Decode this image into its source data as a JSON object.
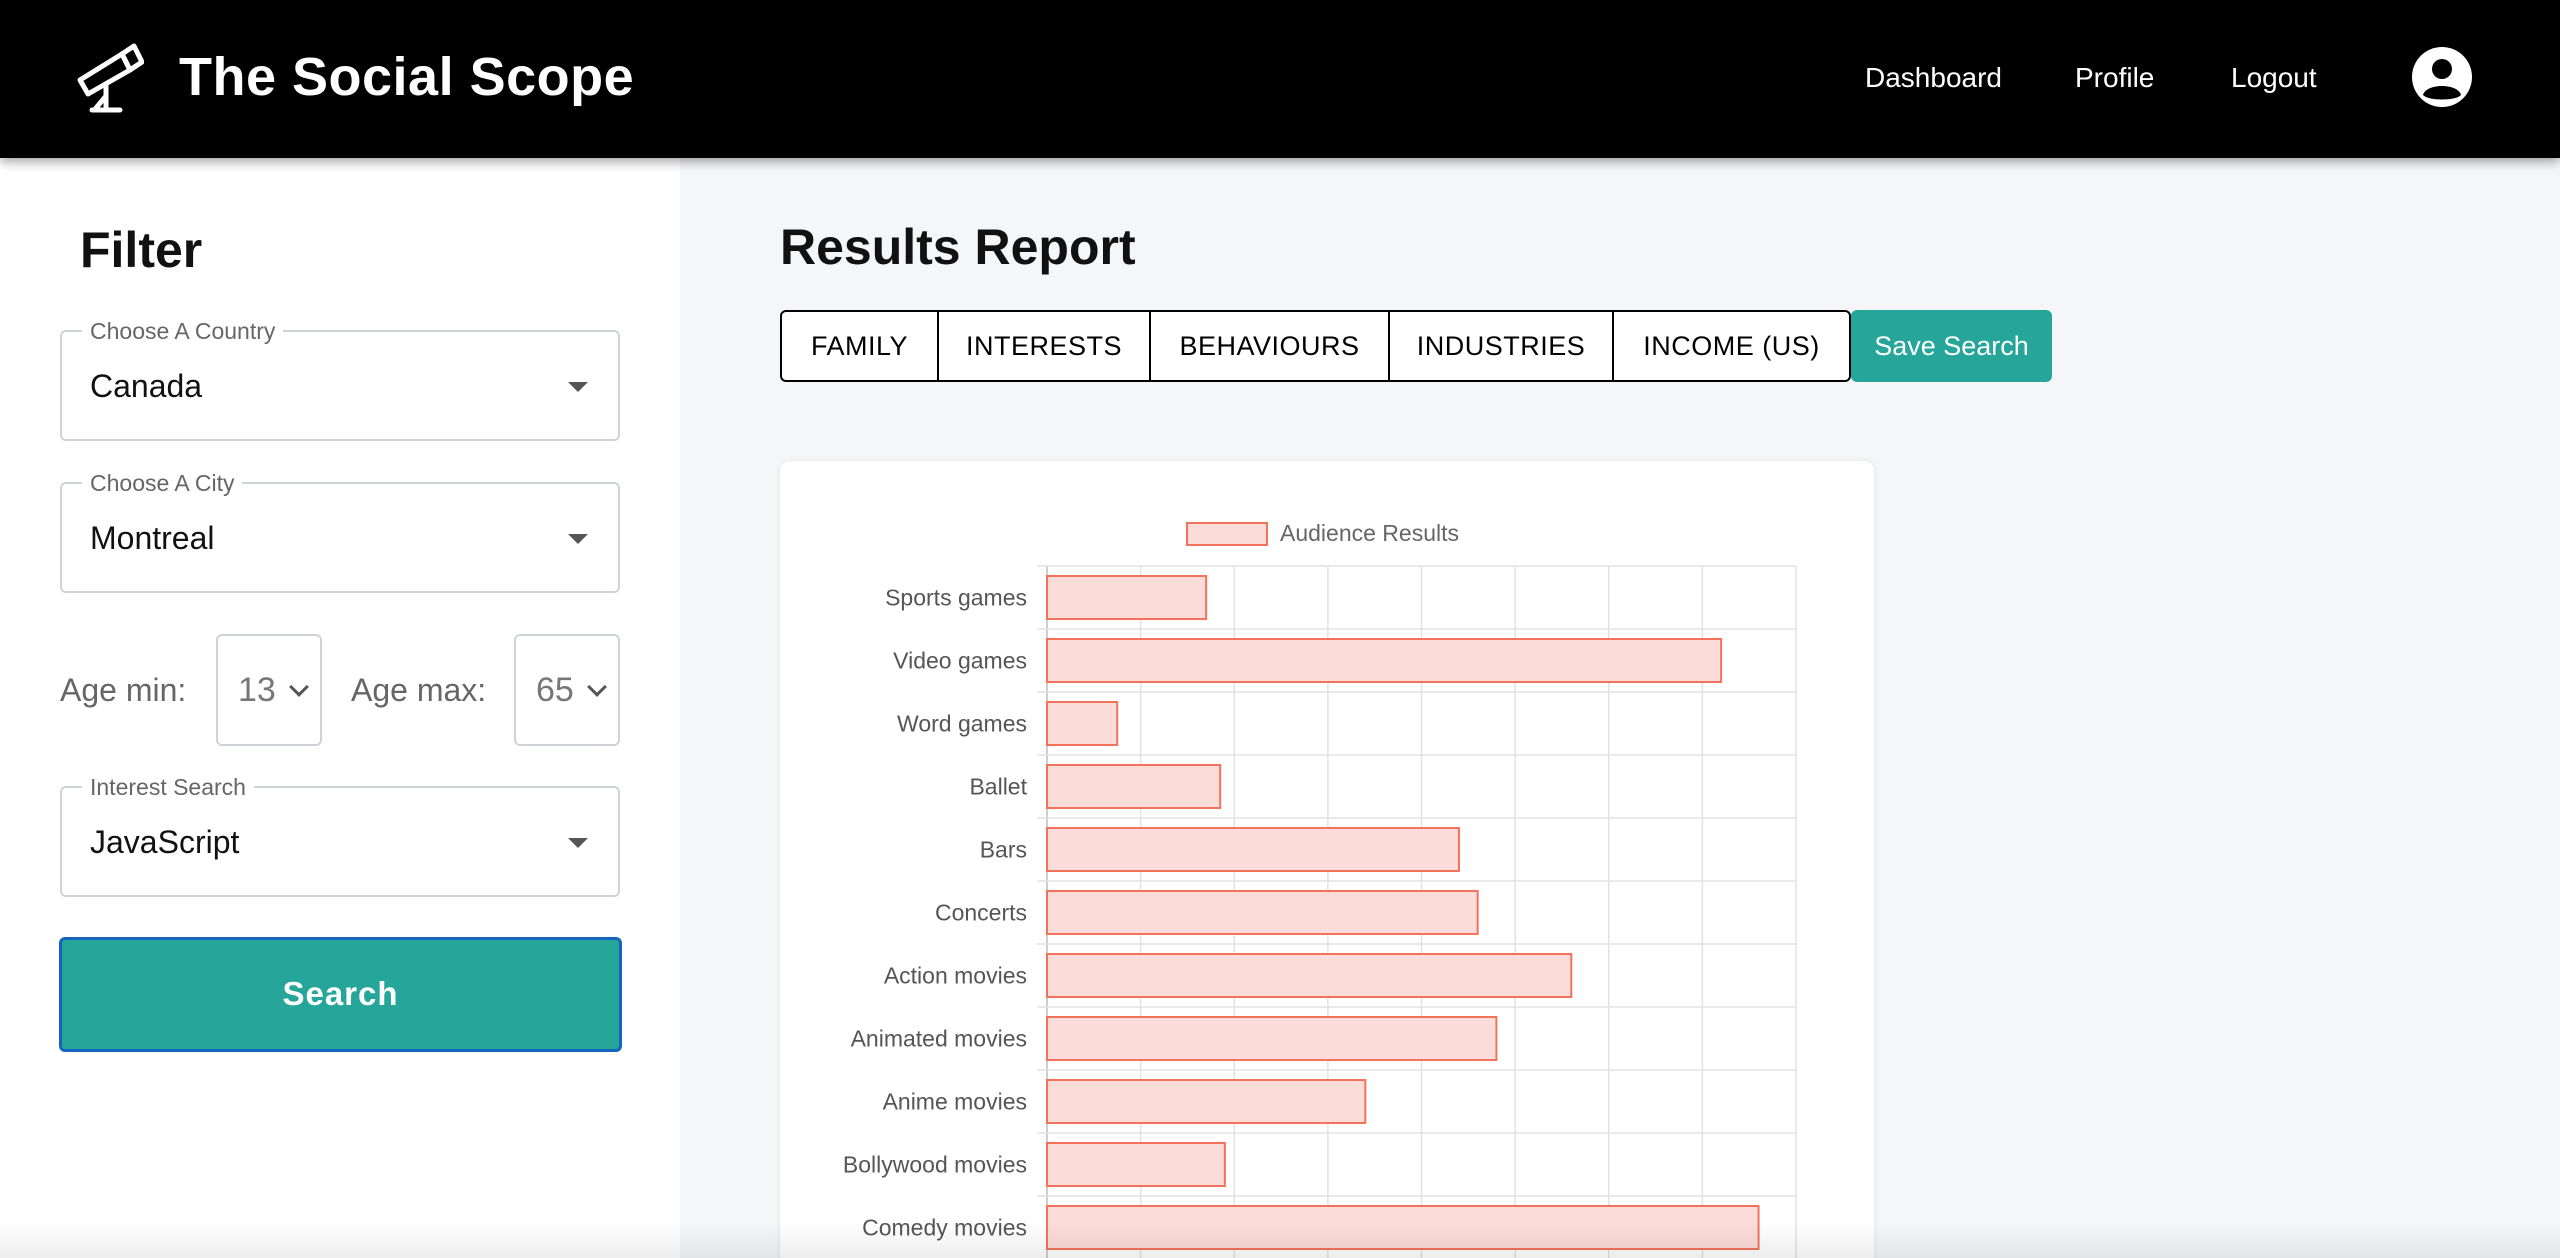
{
  "header": {
    "title": "The Social Scope",
    "nav": {
      "dashboard": "Dashboard",
      "profile": "Profile",
      "logout": "Logout"
    }
  },
  "sidebar": {
    "title": "Filter",
    "country": {
      "label": "Choose A Country",
      "value": "Canada"
    },
    "city": {
      "label": "Choose A City",
      "value": "Montreal"
    },
    "age_min": {
      "label": "Age min:",
      "value": "13"
    },
    "age_max": {
      "label": "Age max:",
      "value": "65"
    },
    "interest": {
      "label": "Interest Search",
      "value": "JavaScript"
    },
    "search_button": "Search"
  },
  "main": {
    "title": "Results Report",
    "tabs": [
      "FAMILY",
      "INTERESTS",
      "BEHAVIOURS",
      "INDUSTRIES",
      "INCOME (US)"
    ],
    "save_button": "Save Search"
  },
  "colors": {
    "accent": "#26a69a",
    "bar_fill": "#fcdcd9",
    "bar_stroke": "#f2735c"
  },
  "chart_data": {
    "type": "bar",
    "orientation": "horizontal",
    "legend": "top",
    "grid": true,
    "series": [
      {
        "name": "Audience Results",
        "values": [
          1.7,
          7.2,
          0.75,
          1.85,
          4.4,
          4.6,
          5.6,
          4.8,
          3.4,
          1.9,
          7.6
        ]
      }
    ],
    "categories": [
      "Sports games",
      "Video games",
      "Word games",
      "Ballet",
      "Bars",
      "Concerts",
      "Action movies",
      "Animated movies",
      "Anime movies",
      "Bollywood movies",
      "Comedy movies"
    ],
    "xlim": [
      0,
      8
    ]
  }
}
